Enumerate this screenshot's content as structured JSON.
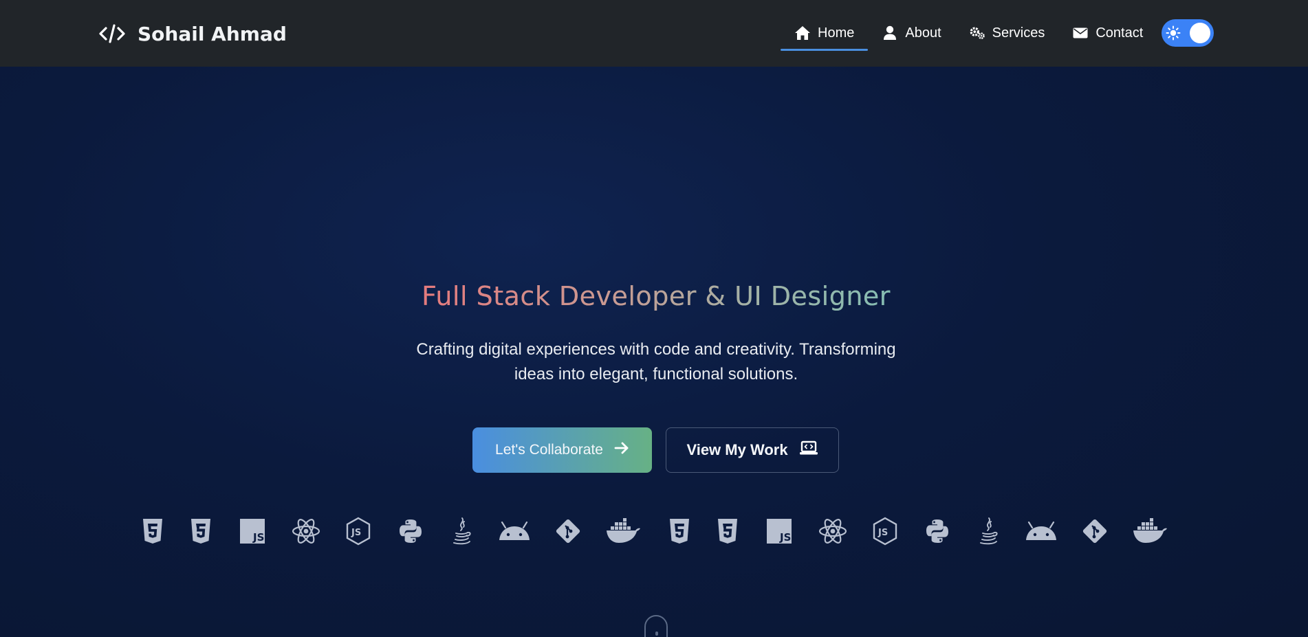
{
  "brand": {
    "name": "Sohail Ahmad",
    "icon": "code-icon"
  },
  "nav": {
    "items": [
      {
        "label": "Home",
        "icon": "home-icon",
        "active": true
      },
      {
        "label": "About",
        "icon": "user-icon",
        "active": false
      },
      {
        "label": "Services",
        "icon": "gears-icon",
        "active": false
      },
      {
        "label": "Contact",
        "icon": "envelope-icon",
        "active": false
      }
    ],
    "theme_toggle": {
      "icon": "sun-icon",
      "state": "on"
    }
  },
  "hero": {
    "title": "Full Stack Developer & UI Designer",
    "subtitle": "Crafting digital experiences with code and creativity. Transforming ideas into elegant, functional solutions.",
    "primary_button": {
      "label": "Let's Collaborate",
      "icon": "arrow-right-icon"
    },
    "secondary_button": {
      "label": "View My Work",
      "icon": "laptop-code-icon"
    }
  },
  "tech_icons": [
    "html5-icon",
    "css3-icon",
    "js-icon",
    "react-icon",
    "nodejs-icon",
    "python-icon",
    "java-icon",
    "android-icon",
    "git-icon",
    "docker-icon",
    "html5-icon",
    "css3-icon",
    "js-icon",
    "react-icon",
    "nodejs-icon",
    "python-icon",
    "java-icon",
    "android-icon",
    "git-icon",
    "docker-icon"
  ],
  "colors": {
    "navbar_bg": "#212529",
    "hero_bg": "#0b1a3a",
    "accent": "#4a8fe0",
    "primary_gradient_start": "#4a8ee0",
    "primary_gradient_end": "#67b185",
    "icon_color": "#b8c0d0"
  }
}
